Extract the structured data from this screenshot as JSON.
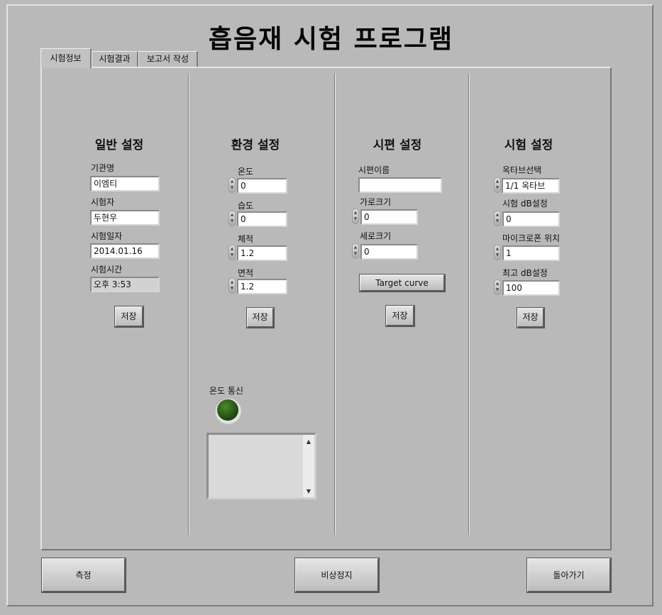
{
  "title": "흡음재 시험 프로그램",
  "tabs": [
    {
      "label": "시험정보",
      "active": true
    },
    {
      "label": "시험결과",
      "active": false
    },
    {
      "label": "보고서 작성",
      "active": false
    }
  ],
  "general": {
    "heading": "일반 설정",
    "org_label": "기관명",
    "org_value": "이엠티",
    "tester_label": "시험자",
    "tester_value": "두현우",
    "date_label": "시험일자",
    "date_value": "2014.01.16",
    "time_label": "시험시간",
    "time_value": "오후 3:53",
    "save_label": "저장"
  },
  "environment": {
    "heading": "환경 설정",
    "temp_label": "온도",
    "temp_value": "0",
    "humidity_label": "습도",
    "humidity_value": "0",
    "volume_label": "체적",
    "volume_value": "1.2",
    "area_label": "면적",
    "area_value": "1.2",
    "save_label": "저장",
    "comm_label": "온도 통신",
    "comm_led_color": "#2a5a18",
    "log_text": ""
  },
  "specimen": {
    "heading": "시편 설정",
    "name_label": "시편이름",
    "name_value": "",
    "width_label": "가로크기",
    "width_value": "0",
    "height_label": "세로크기",
    "height_value": "0",
    "target_curve_label": "Target curve",
    "save_label": "저장"
  },
  "test": {
    "heading": "시험 설정",
    "octave_label": "옥타브선택",
    "octave_value": "1/1 옥타브",
    "db_label": "시험 dB설정",
    "db_value": "0",
    "mic_label": "마이크로폰 위치",
    "mic_value": "1",
    "max_db_label": "최고 dB설정",
    "max_db_value": "100",
    "save_label": "저장"
  },
  "footer": {
    "measure_label": "측정",
    "estop_label": "비상정지",
    "back_label": "돌아가기"
  },
  "icons": {
    "spin_up": "▲",
    "spin_down": "▼",
    "scroll_up": "▲",
    "scroll_down": "▼"
  }
}
